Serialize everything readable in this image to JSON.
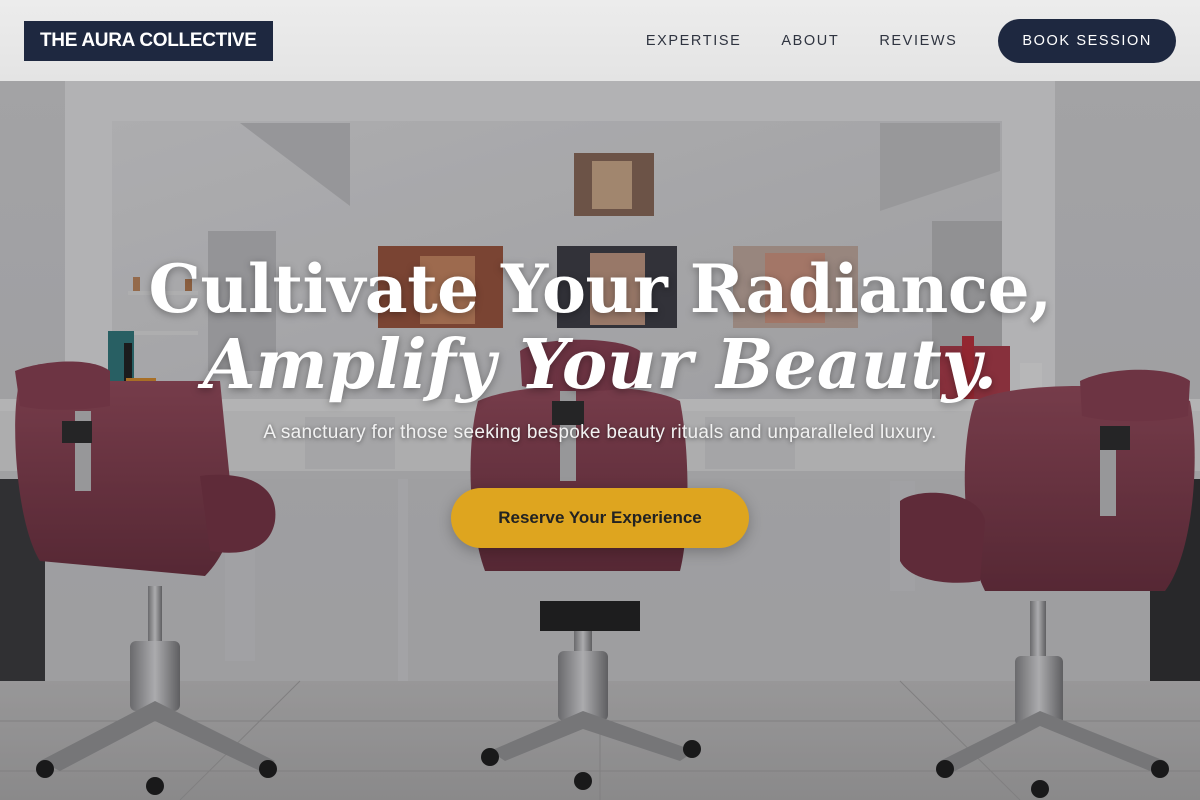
{
  "nav": {
    "logo": "THE AURA COLLECTIVE",
    "links": [
      "EXPERTISE",
      "ABOUT",
      "REVIEWS"
    ],
    "cta": "BOOK SESSION"
  },
  "hero": {
    "headline_line1": "Cultivate Your Radiance,",
    "headline_line2": "Amplify Your Beauty.",
    "subheadline": "A sanctuary for those seeking bespoke beauty rituals and unparalleled luxury.",
    "cta": "Reserve Your Experience",
    "background": "salon-interior-photo"
  },
  "colors": {
    "navy": "#1e2840",
    "gold": "#dea51f",
    "nav_bg": "#e8e8e8"
  }
}
